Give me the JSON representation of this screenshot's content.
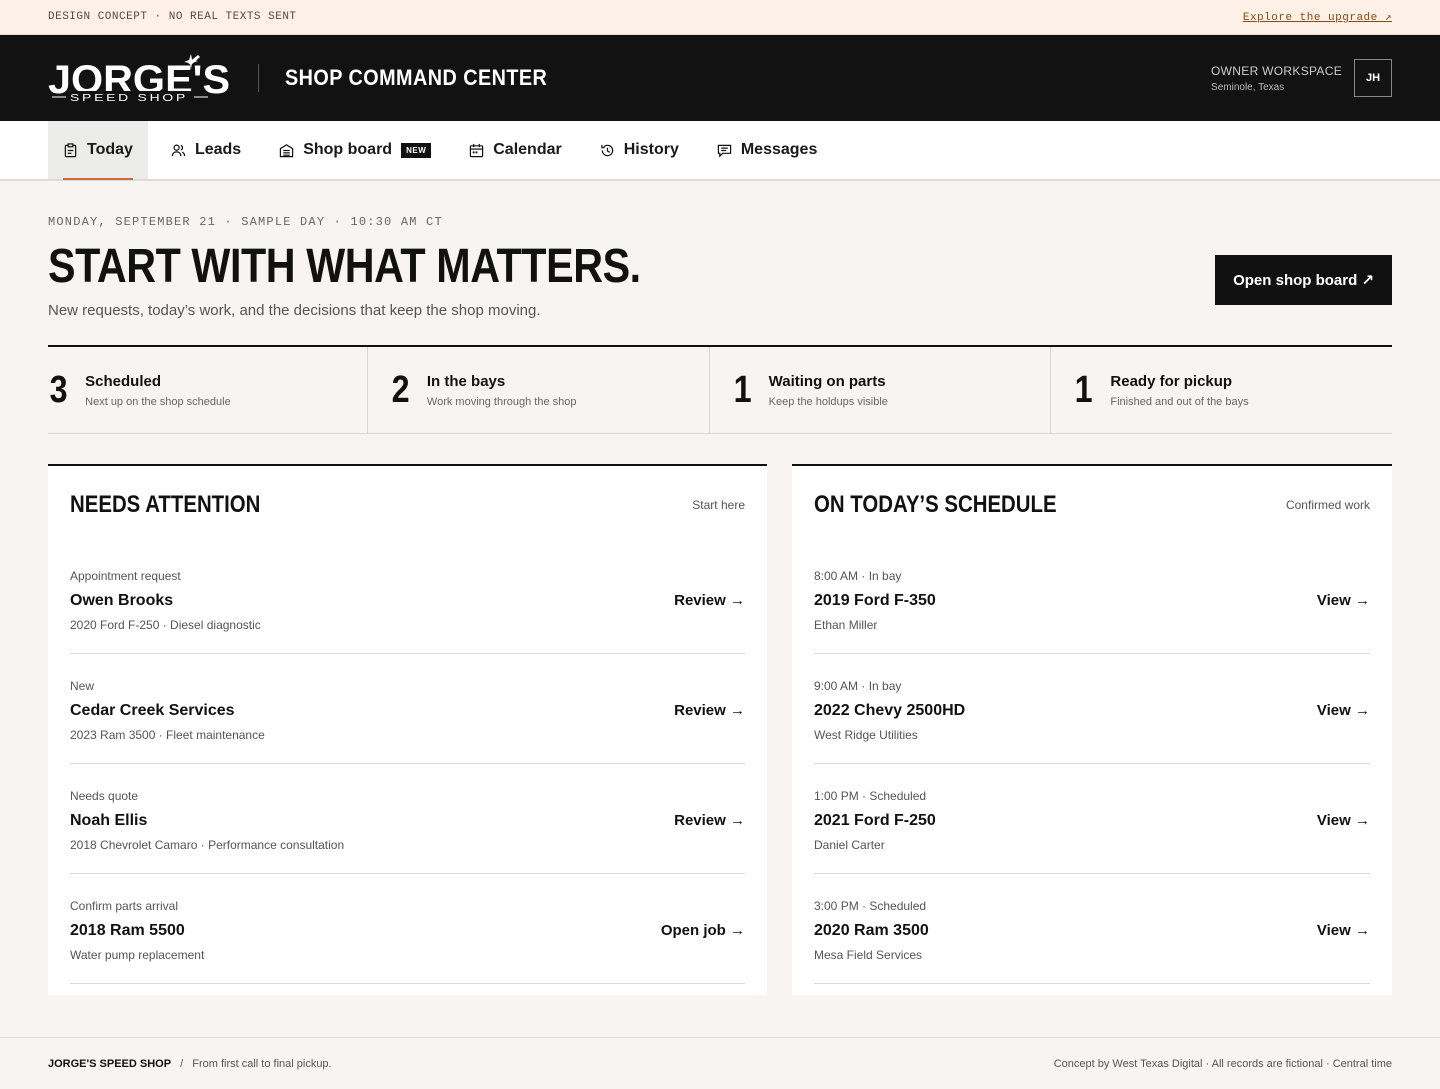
{
  "topbar": {
    "notice": "DESIGN CONCEPT · NO REAL TEXTS SENT",
    "link": "Explore the upgrade ↗"
  },
  "header": {
    "logo_text": "JORGE'S",
    "logo_sub": "SPEED SHOP",
    "title": "SHOP COMMAND CENTER",
    "workspace_title": "OWNER WORKSPACE",
    "workspace_location": "Seminole, Texas",
    "avatar": "JH"
  },
  "nav": {
    "today": "Today",
    "leads": "Leads",
    "shop_board": "Shop board",
    "shop_board_badge": "NEW",
    "calendar": "Calendar",
    "history": "History",
    "messages": "Messages"
  },
  "hero": {
    "eyebrow": "MONDAY, SEPTEMBER 21 · SAMPLE DAY · 10:30 AM CT",
    "title": "START WITH WHAT MATTERS.",
    "subtitle": "New requests, today’s work, and the decisions that keep the shop moving.",
    "button": "Open shop board ↗"
  },
  "stats": [
    {
      "value": "3",
      "label": "Scheduled",
      "sub": "Next up on the shop schedule"
    },
    {
      "value": "2",
      "label": "In the bays",
      "sub": "Work moving through the shop"
    },
    {
      "value": "1",
      "label": "Waiting on parts",
      "sub": "Keep the holdups visible"
    },
    {
      "value": "1",
      "label": "Ready for pickup",
      "sub": "Finished and out of the bays"
    }
  ],
  "attention": {
    "title": "NEEDS ATTENTION",
    "note": "Start here",
    "rows": [
      {
        "meta": "Appointment request",
        "title": "Owen Brooks",
        "sub": "2020 Ford F-250 · Diesel diagnostic",
        "action": "Review →"
      },
      {
        "meta": "New",
        "title": "Cedar Creek Services",
        "sub": "2023 Ram 3500 · Fleet maintenance",
        "action": "Review →"
      },
      {
        "meta": "Needs quote",
        "title": "Noah Ellis",
        "sub": "2018 Chevrolet Camaro · Performance consultation",
        "action": "Review →"
      },
      {
        "meta": "Confirm parts arrival",
        "title": "2018 Ram 5500",
        "sub": "Water pump replacement",
        "action": "Open job →"
      }
    ]
  },
  "schedule": {
    "title": "ON TODAY’S SCHEDULE",
    "note": "Confirmed work",
    "rows": [
      {
        "meta": "8:00 AM · In bay",
        "title": "2019 Ford F-350",
        "sub": "Ethan Miller",
        "action": "View →"
      },
      {
        "meta": "9:00 AM · In bay",
        "title": "2022 Chevy 2500HD",
        "sub": "West Ridge Utilities",
        "action": "View →"
      },
      {
        "meta": "1:00 PM · Scheduled",
        "title": "2021 Ford F-250",
        "sub": "Daniel Carter",
        "action": "View →"
      },
      {
        "meta": "3:00 PM · Scheduled",
        "title": "2020 Ram 3500",
        "sub": "Mesa Field Services",
        "action": "View →"
      }
    ]
  },
  "footer": {
    "brand": "JORGE'S SPEED SHOP",
    "sep": "/",
    "tagline": "From first call to final pickup.",
    "credit": "Concept by West Texas Digital · All records are fictional · Central time"
  }
}
